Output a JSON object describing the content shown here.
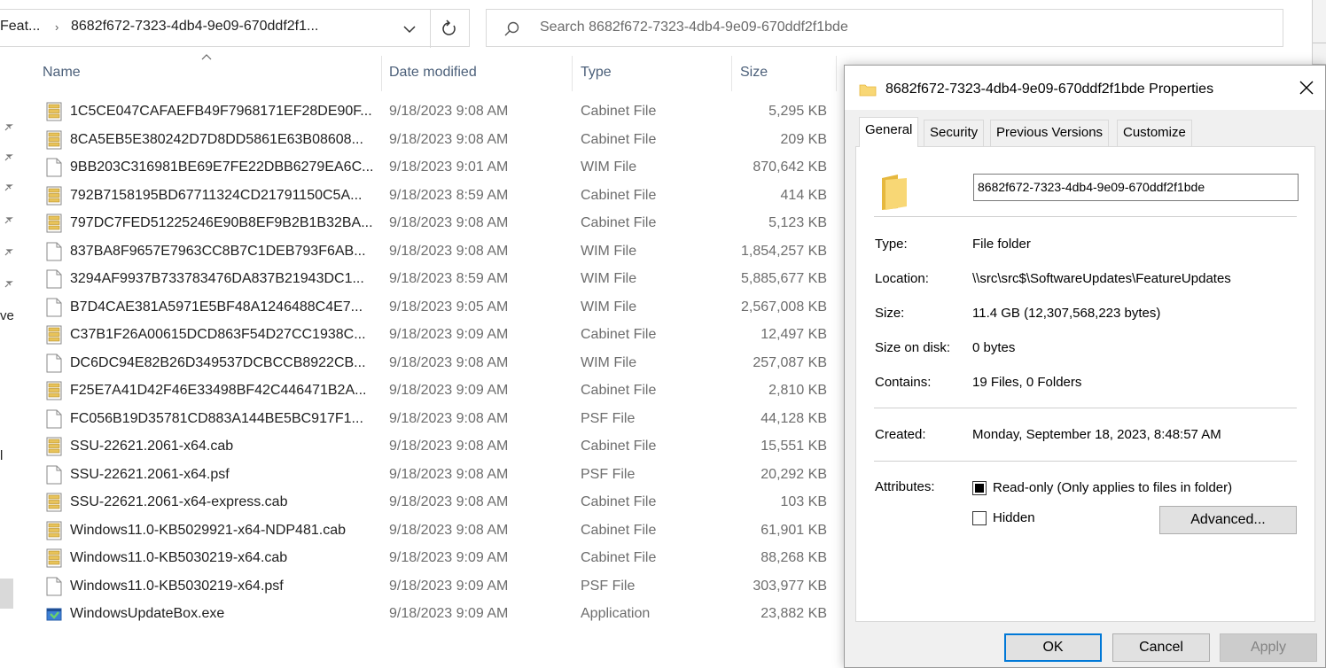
{
  "explorer": {
    "breadcrumb": {
      "parent": "Feat...",
      "current": "8682f672-7323-4db4-9e09-670ddf2f1..."
    },
    "search": {
      "placeholder": "Search 8682f672-7323-4db4-9e09-670ddf2f1bde"
    },
    "nav_labels": {
      "item_a": "ve",
      "item_b": "l"
    },
    "columns": {
      "name": "Name",
      "date": "Date modified",
      "type": "Type",
      "size": "Size"
    },
    "files": [
      {
        "name": "1C5CE047CAFAEFB49F7968171EF28DE90F...",
        "date": "9/18/2023 9:08 AM",
        "type": "Cabinet File",
        "size": "5,295 KB",
        "icon": "cabinet-file-icon"
      },
      {
        "name": "8CA5EB5E380242D7D8DD5861E63B08608...",
        "date": "9/18/2023 9:08 AM",
        "type": "Cabinet File",
        "size": "209 KB",
        "icon": "cabinet-file-icon"
      },
      {
        "name": "9BB203C316981BE69E7FE22DBB6279EA6C...",
        "date": "9/18/2023 9:01 AM",
        "type": "WIM File",
        "size": "870,642 KB",
        "icon": "blank-file-icon"
      },
      {
        "name": "792B7158195BD67711324CD21791150C5A...",
        "date": "9/18/2023 8:59 AM",
        "type": "Cabinet File",
        "size": "414 KB",
        "icon": "cabinet-file-icon"
      },
      {
        "name": "797DC7FED51225246E90B8EF9B2B1B32BA...",
        "date": "9/18/2023 9:08 AM",
        "type": "Cabinet File",
        "size": "5,123 KB",
        "icon": "cabinet-file-icon"
      },
      {
        "name": "837BA8F9657E7963CC8B7C1DEB793F6AB...",
        "date": "9/18/2023 9:08 AM",
        "type": "WIM File",
        "size": "1,854,257 KB",
        "icon": "blank-file-icon"
      },
      {
        "name": "3294AF9937B733783476DA837B21943DC1...",
        "date": "9/18/2023 8:59 AM",
        "type": "WIM File",
        "size": "5,885,677 KB",
        "icon": "blank-file-icon"
      },
      {
        "name": "B7D4CAE381A5971E5BF48A1246488C4E7...",
        "date": "9/18/2023 9:05 AM",
        "type": "WIM File",
        "size": "2,567,008 KB",
        "icon": "blank-file-icon"
      },
      {
        "name": "C37B1F26A00615DCD863F54D27CC1938C...",
        "date": "9/18/2023 9:09 AM",
        "type": "Cabinet File",
        "size": "12,497 KB",
        "icon": "cabinet-file-icon"
      },
      {
        "name": "DC6DC94E82B26D349537DCBCCB8922CB...",
        "date": "9/18/2023 9:08 AM",
        "type": "WIM File",
        "size": "257,087 KB",
        "icon": "blank-file-icon"
      },
      {
        "name": "F25E7A41D42F46E33498BF42C446471B2A...",
        "date": "9/18/2023 9:09 AM",
        "type": "Cabinet File",
        "size": "2,810 KB",
        "icon": "cabinet-file-icon"
      },
      {
        "name": "FC056B19D35781CD883A144BE5BC917F1...",
        "date": "9/18/2023 9:08 AM",
        "type": "PSF File",
        "size": "44,128 KB",
        "icon": "blank-file-icon"
      },
      {
        "name": "SSU-22621.2061-x64.cab",
        "date": "9/18/2023 9:08 AM",
        "type": "Cabinet File",
        "size": "15,551 KB",
        "icon": "cabinet-file-icon"
      },
      {
        "name": "SSU-22621.2061-x64.psf",
        "date": "9/18/2023 9:08 AM",
        "type": "PSF File",
        "size": "20,292 KB",
        "icon": "blank-file-icon"
      },
      {
        "name": "SSU-22621.2061-x64-express.cab",
        "date": "9/18/2023 9:08 AM",
        "type": "Cabinet File",
        "size": "103 KB",
        "icon": "cabinet-file-icon"
      },
      {
        "name": "Windows11.0-KB5029921-x64-NDP481.cab",
        "date": "9/18/2023 9:08 AM",
        "type": "Cabinet File",
        "size": "61,901 KB",
        "icon": "cabinet-file-icon"
      },
      {
        "name": "Windows11.0-KB5030219-x64.cab",
        "date": "9/18/2023 9:09 AM",
        "type": "Cabinet File",
        "size": "88,268 KB",
        "icon": "cabinet-file-icon"
      },
      {
        "name": "Windows11.0-KB5030219-x64.psf",
        "date": "9/18/2023 9:09 AM",
        "type": "PSF File",
        "size": "303,977 KB",
        "icon": "blank-file-icon"
      },
      {
        "name": "WindowsUpdateBox.exe",
        "date": "9/18/2023 9:09 AM",
        "type": "Application",
        "size": "23,882 KB",
        "icon": "application-icon"
      }
    ]
  },
  "properties": {
    "title": "8682f672-7323-4db4-9e09-670ddf2f1bde Properties",
    "tabs": [
      "General",
      "Security",
      "Previous Versions",
      "Customize"
    ],
    "active_tab": "General",
    "folder_name": "8682f672-7323-4db4-9e09-670ddf2f1bde",
    "fields": {
      "type": {
        "label": "Type:",
        "value": "File folder"
      },
      "location": {
        "label": "Location:",
        "value": "\\\\src\\src$\\SoftwareUpdates\\FeatureUpdates"
      },
      "size": {
        "label": "Size:",
        "value": "11.4 GB (12,307,568,223 bytes)"
      },
      "size_on_disk": {
        "label": "Size on disk:",
        "value": "0 bytes"
      },
      "contains": {
        "label": "Contains:",
        "value": "19 Files, 0 Folders"
      },
      "created": {
        "label": "Created:",
        "value": "Monday, September 18, 2023, 8:48:57 AM"
      },
      "attributes": {
        "label": "Attributes:"
      }
    },
    "attributes": {
      "read_only": {
        "label": "Read-only (Only applies to files in folder)",
        "state": "indeterminate"
      },
      "hidden": {
        "label": "Hidden",
        "state": "unchecked"
      }
    },
    "buttons": {
      "advanced": "Advanced...",
      "ok": "OK",
      "cancel": "Cancel",
      "apply": "Apply"
    }
  },
  "colors": {
    "accent": "#0078d7",
    "folder_yellow": "#f8d775",
    "folder_dark": "#e6b83e",
    "dialog_bg": "#f0f0f0",
    "header_text": "#4c607a"
  }
}
